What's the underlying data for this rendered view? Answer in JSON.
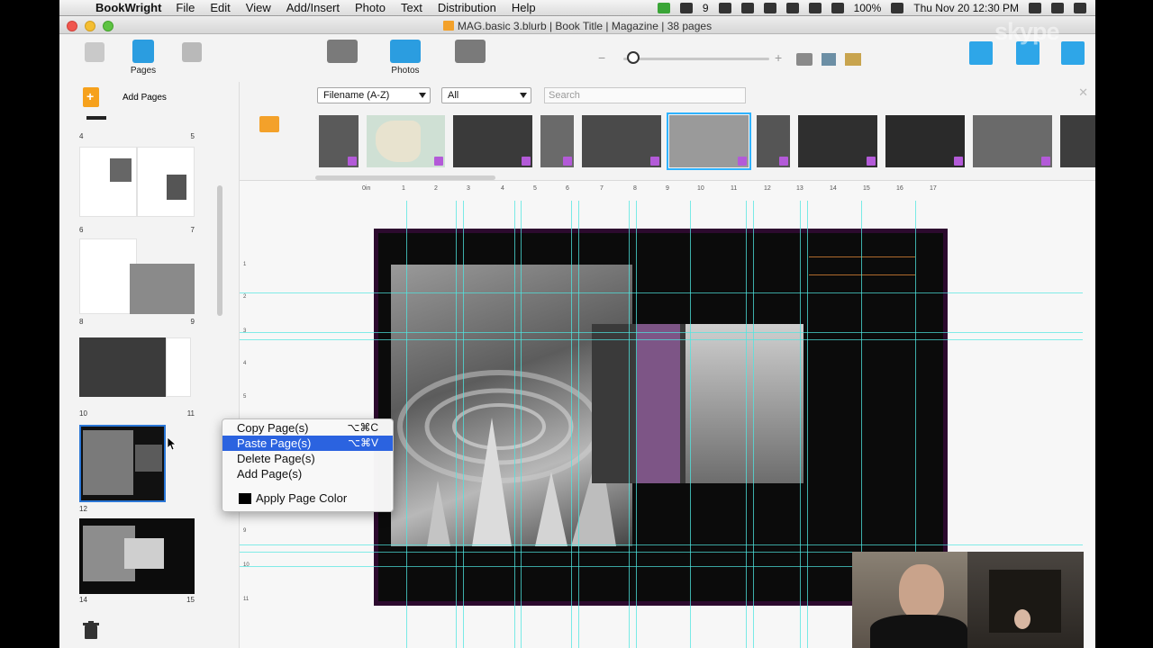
{
  "menubar": {
    "app_name": "BookWright",
    "items": [
      "File",
      "Edit",
      "View",
      "Add/Insert",
      "Photo",
      "Text",
      "Distribution",
      "Help"
    ],
    "status": {
      "app_indicator": "9",
      "battery": "100%",
      "datetime": "Thu Nov 20  12:30 PM"
    }
  },
  "window": {
    "title": "MAG.basic 3.blurb | Book Title | Magazine | 38 pages"
  },
  "toolbar": {
    "pages_label": "Pages",
    "photos_label": "Photos"
  },
  "sidebar": {
    "add_pages_label": "Add Pages",
    "spreads": [
      {
        "left": "4",
        "right": "5"
      },
      {
        "left": "6",
        "right": "7"
      },
      {
        "left": "8",
        "right": "9"
      },
      {
        "left": "10",
        "right": "11"
      },
      {
        "left": "12",
        "right": ""
      },
      {
        "left": "14",
        "right": "15"
      }
    ]
  },
  "photo_panel": {
    "sort_value": "Filename (A-Z)",
    "filter_value": "All",
    "search_placeholder": "Search"
  },
  "ruler": {
    "h_labels": [
      "0in",
      "1",
      "2",
      "3",
      "4",
      "5",
      "6",
      "7",
      "8",
      "9",
      "10",
      "11",
      "12",
      "13",
      "14",
      "15",
      "16",
      "17"
    ],
    "v_labels": [
      "1",
      "2",
      "3",
      "4",
      "5",
      "6",
      "7",
      "8",
      "9",
      "10",
      "11"
    ]
  },
  "context_menu": {
    "items": [
      {
        "label": "Copy Page(s)",
        "shortcut": "⌥⌘C"
      },
      {
        "label": "Paste Page(s)",
        "shortcut": "⌥⌘V"
      },
      {
        "label": "Delete Page(s)",
        "shortcut": ""
      },
      {
        "label": "Add Page(s)",
        "shortcut": ""
      }
    ],
    "apply_color_label": "Apply Page Color"
  },
  "watermark": "skype",
  "colors": {
    "selection": "#2b63e0",
    "accent_orange": "#f3a12a",
    "guide": "#4fe6e0",
    "page_bleed": "#2c0a2e"
  }
}
